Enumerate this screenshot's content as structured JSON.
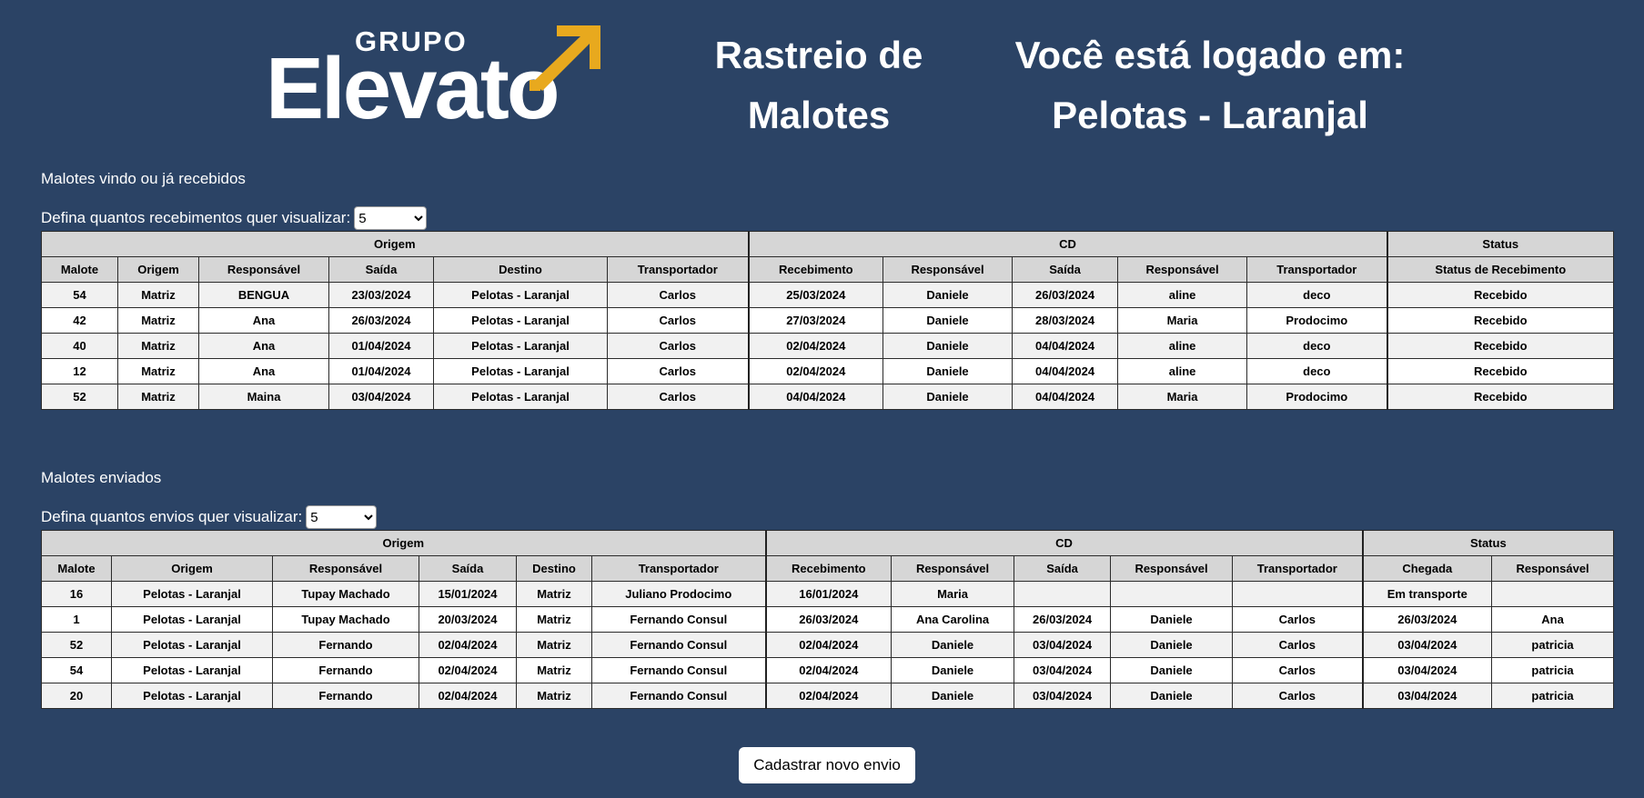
{
  "header": {
    "logo_top": "GRUPO",
    "logo_main": "Elevato",
    "title_line1": "Rastreio de",
    "title_line2": "Malotes",
    "login_line1": "Você está logado em:",
    "login_line2": "Pelotas - Laranjal"
  },
  "received": {
    "section_title": "Malotes vindo ou já recebidos",
    "selector_label": "Defina quantos recebimentos quer visualizar:",
    "selector_value": "5",
    "groups": [
      "Origem",
      "CD",
      "Status"
    ],
    "columns": [
      "Malote",
      "Origem",
      "Responsável",
      "Saída",
      "Destino",
      "Transportador",
      "Recebimento",
      "Responsável",
      "Saída",
      "Responsável",
      "Transportador",
      "Status de Recebimento"
    ],
    "rows": [
      [
        "54",
        "Matriz",
        "BENGUA",
        "23/03/2024",
        "Pelotas - Laranjal",
        "Carlos",
        "25/03/2024",
        "Daniele",
        "26/03/2024",
        "aline",
        "deco",
        "Recebido"
      ],
      [
        "42",
        "Matriz",
        "Ana",
        "26/03/2024",
        "Pelotas - Laranjal",
        "Carlos",
        "27/03/2024",
        "Daniele",
        "28/03/2024",
        "Maria",
        "Prodocimo",
        "Recebido"
      ],
      [
        "40",
        "Matriz",
        "Ana",
        "01/04/2024",
        "Pelotas - Laranjal",
        "Carlos",
        "02/04/2024",
        "Daniele",
        "04/04/2024",
        "aline",
        "deco",
        "Recebido"
      ],
      [
        "12",
        "Matriz",
        "Ana",
        "01/04/2024",
        "Pelotas - Laranjal",
        "Carlos",
        "02/04/2024",
        "Daniele",
        "04/04/2024",
        "aline",
        "deco",
        "Recebido"
      ],
      [
        "52",
        "Matriz",
        "Maina",
        "03/04/2024",
        "Pelotas - Laranjal",
        "Carlos",
        "04/04/2024",
        "Daniele",
        "04/04/2024",
        "Maria",
        "Prodocimo",
        "Recebido"
      ]
    ]
  },
  "sent": {
    "section_title": "Malotes enviados",
    "selector_label": "Defina quantos envios quer visualizar:",
    "selector_value": "5",
    "groups": [
      "Origem",
      "CD",
      "Status"
    ],
    "columns": [
      "Malote",
      "Origem",
      "Responsável",
      "Saída",
      "Destino",
      "Transportador",
      "Recebimento",
      "Responsável",
      "Saída",
      "Responsável",
      "Transportador",
      "Chegada",
      "Responsável"
    ],
    "rows": [
      [
        "16",
        "Pelotas - Laranjal",
        "Tupay Machado",
        "15/01/2024",
        "Matriz",
        "Juliano Prodocimo",
        "16/01/2024",
        "Maria",
        "",
        "",
        "",
        "Em transporte",
        ""
      ],
      [
        "1",
        "Pelotas - Laranjal",
        "Tupay Machado",
        "20/03/2024",
        "Matriz",
        "Fernando Consul",
        "26/03/2024",
        "Ana Carolina",
        "26/03/2024",
        "Daniele",
        "Carlos",
        "26/03/2024",
        "Ana"
      ],
      [
        "52",
        "Pelotas - Laranjal",
        "Fernando",
        "02/04/2024",
        "Matriz",
        "Fernando Consul",
        "02/04/2024",
        "Daniele",
        "03/04/2024",
        "Daniele",
        "Carlos",
        "03/04/2024",
        "patricia"
      ],
      [
        "54",
        "Pelotas - Laranjal",
        "Fernando",
        "02/04/2024",
        "Matriz",
        "Fernando Consul",
        "02/04/2024",
        "Daniele",
        "03/04/2024",
        "Daniele",
        "Carlos",
        "03/04/2024",
        "patricia"
      ],
      [
        "20",
        "Pelotas - Laranjal",
        "Fernando",
        "02/04/2024",
        "Matriz",
        "Fernando Consul",
        "02/04/2024",
        "Daniele",
        "03/04/2024",
        "Daniele",
        "Carlos",
        "03/04/2024",
        "patricia"
      ]
    ]
  },
  "actions": {
    "new_shipment_label": "Cadastrar novo envio"
  },
  "colors": {
    "background": "#2b4365",
    "logo_arrow": "#e8a91e",
    "header_cell": "#d6d6d6"
  }
}
